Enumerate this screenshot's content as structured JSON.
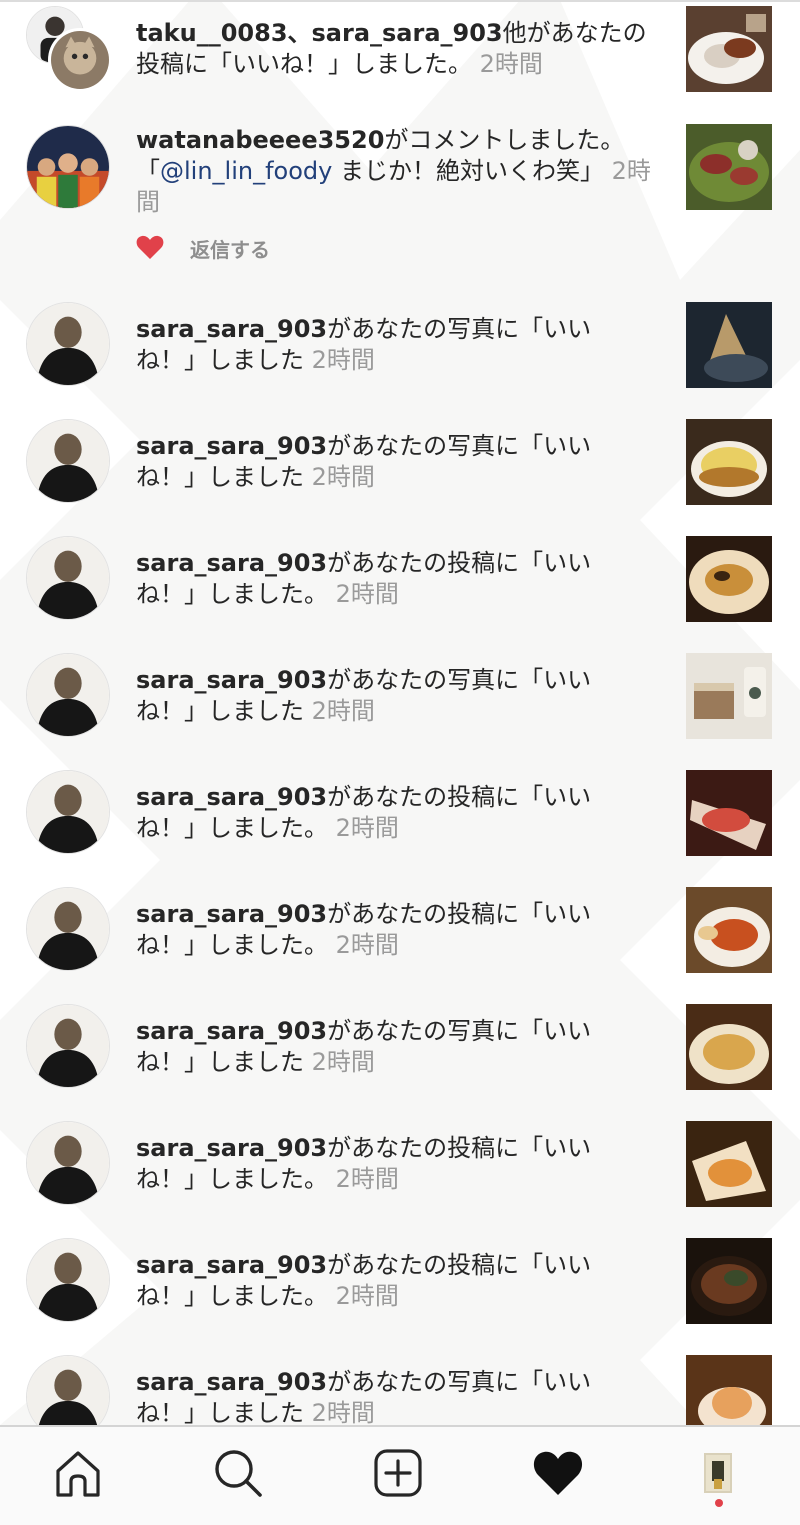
{
  "notifications": [
    {
      "type": "like-group",
      "user": "taku__0083、sara_sara_903",
      "text": "他があなたの投稿に「いいね！」しました。",
      "time": "2時間",
      "thumb_colors": [
        "#5a4030",
        "#d9cfc3",
        "#7b3a1f"
      ]
    },
    {
      "type": "comment",
      "user": "watanabeeee3520",
      "text": "がコメントしました。",
      "quote_open": "「",
      "mention": "@lin_lin_foody",
      "comment": " まじか！絶対いくわ笑」",
      "time": "2時間",
      "reply_label": "返信する",
      "thumb_colors": [
        "#4b5c2a",
        "#8c2f2a",
        "#d8d2c4"
      ]
    },
    {
      "type": "like",
      "user": "sara_sara_903",
      "text": "があなたの写真に「いいね！」しました",
      "time": "2時間",
      "thumb_colors": [
        "#1d2630",
        "#b89a6a",
        "#3d4a58"
      ]
    },
    {
      "type": "like",
      "user": "sara_sara_903",
      "text": "があなたの写真に「いいね！」しました",
      "time": "2時間",
      "thumb_colors": [
        "#3a2a1c",
        "#e9cf63",
        "#b2782c"
      ]
    },
    {
      "type": "like",
      "user": "sara_sara_903",
      "text": "があなたの投稿に「いいね！」しました。",
      "time": "2時間",
      "thumb_colors": [
        "#2a1a10",
        "#c98f3a",
        "#efdcbc"
      ]
    },
    {
      "type": "like",
      "user": "sara_sara_903",
      "text": "があなたの写真に「いいね！」しました",
      "time": "2時間",
      "thumb_colors": [
        "#e8e4dc",
        "#9a7a5a",
        "#4b5a4e"
      ]
    },
    {
      "type": "like",
      "user": "sara_sara_903",
      "text": "があなたの投稿に「いいね！」しました。",
      "time": "2時間",
      "thumb_colors": [
        "#3c1a14",
        "#d24c3e",
        "#e7d2c1"
      ]
    },
    {
      "type": "like",
      "user": "sara_sara_903",
      "text": "があなたの投稿に「いいね！」しました。",
      "time": "2時間",
      "thumb_colors": [
        "#6b4a2a",
        "#c8501f",
        "#f3ede3"
      ]
    },
    {
      "type": "like",
      "user": "sara_sara_903",
      "text": "があなたの写真に「いいね！」しました",
      "time": "2時間",
      "thumb_colors": [
        "#4a2c16",
        "#d9a64d",
        "#efe2c8"
      ]
    },
    {
      "type": "like",
      "user": "sara_sara_903",
      "text": "があなたの投稿に「いいね！」しました。",
      "time": "2時間",
      "thumb_colors": [
        "#3a2410",
        "#e2913a",
        "#f2e0c3"
      ]
    },
    {
      "type": "like",
      "user": "sara_sara_903",
      "text": "があなたの投稿に「いいね！」しました。",
      "time": "2時間",
      "thumb_colors": [
        "#1a120c",
        "#6a3a20",
        "#3a4a2a"
      ]
    },
    {
      "type": "like",
      "user": "sara_sara_903",
      "text": "があなたの写真に「いいね！」しました",
      "time": "2時間",
      "thumb_colors": [
        "#5a3418",
        "#e7a15d",
        "#f4e3cf"
      ]
    }
  ],
  "tabbar": {
    "tabs": [
      "home",
      "search",
      "add",
      "activity",
      "profile"
    ],
    "icons": [
      "home-icon",
      "search-icon",
      "add-post-icon",
      "heart-icon",
      "profile-avatar"
    ]
  },
  "colors": {
    "username": "#262626",
    "timestamp": "#9a9a9a",
    "mention": "#22407a",
    "like_heart": "#e1414a",
    "background": "#f7f7f6"
  }
}
